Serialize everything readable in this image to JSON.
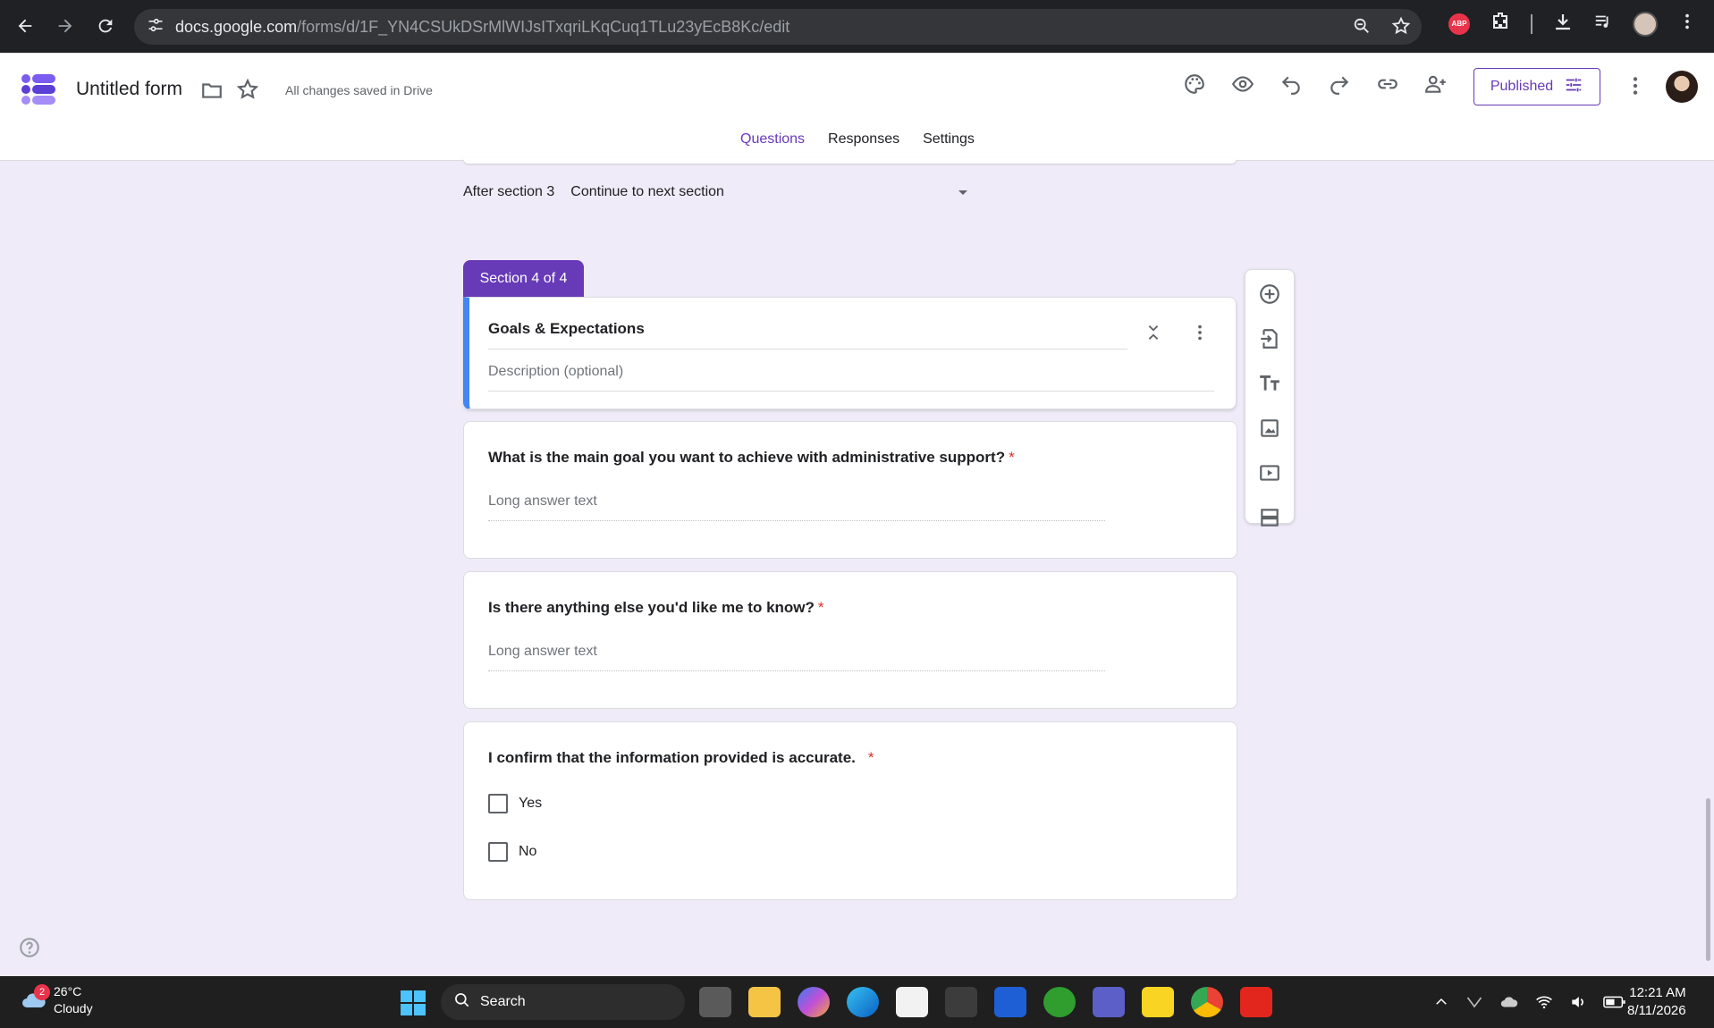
{
  "browser": {
    "url_domain": "docs.google.com",
    "url_path": "/forms/d/1F_YN4CSUkDSrMlWIJsITxqriLKqCuq1TLu23yEcB8Kc/edit",
    "ext_abp": "ABP"
  },
  "header": {
    "form_title": "Untitled form",
    "save_status": "All changes saved in Drive",
    "publish_label": "Published",
    "tabs": [
      {
        "label": "Questions",
        "active": true
      },
      {
        "label": "Responses",
        "active": false
      },
      {
        "label": "Settings",
        "active": false
      }
    ]
  },
  "after_section": {
    "label": "After section 3",
    "value": "Continue to next section"
  },
  "section": {
    "badge": "Section 4 of 4",
    "title": "Goals & Expectations",
    "description_placeholder": "Description (optional)"
  },
  "questions": [
    {
      "title": "What is the main goal you want to achieve with administrative support?",
      "required": "*",
      "answer_placeholder": "Long answer text"
    },
    {
      "title": "Is there anything else you'd like me to know?",
      "required": "*",
      "answer_placeholder": "Long answer text"
    },
    {
      "title": "I confirm that the information provided is accurate.",
      "required": "*",
      "options": [
        "Yes",
        "No"
      ]
    }
  ],
  "taskbar": {
    "weather_temp": "26°C",
    "weather_desc": "Cloudy",
    "weather_badge": "2",
    "search_label": "Search",
    "time": "12:21 AM",
    "date": "8/11/2026"
  },
  "colors": {
    "accent": "#673ab7",
    "section_border": "#4285f4",
    "required": "#d93025",
    "background": "#f0ebf8"
  }
}
